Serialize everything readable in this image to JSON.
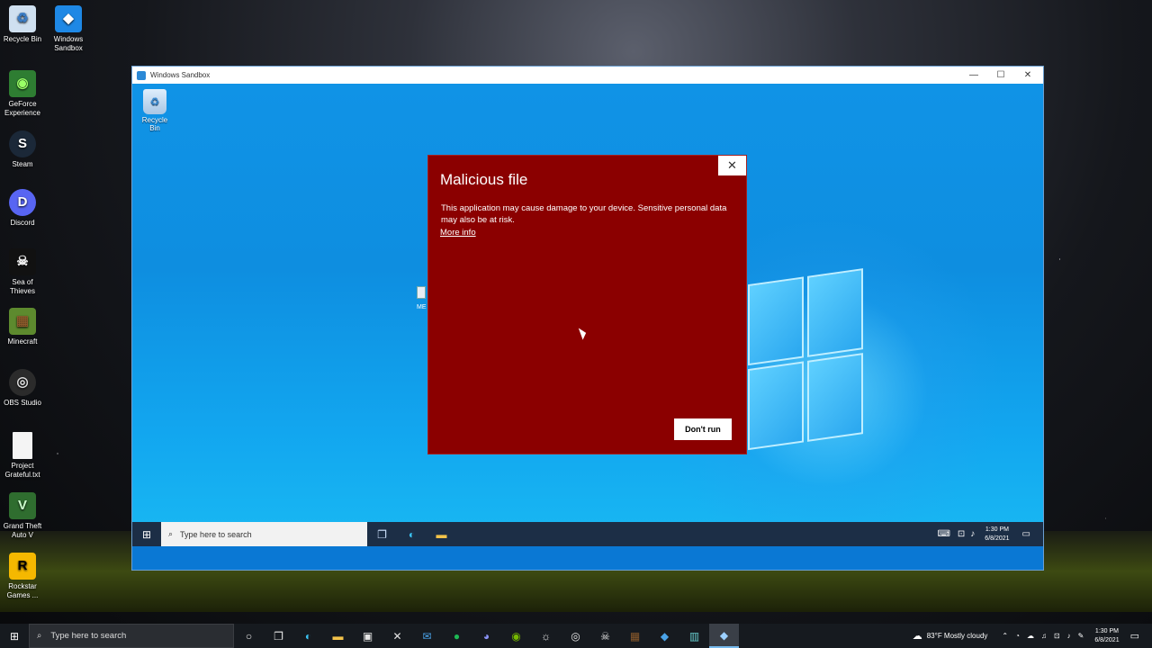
{
  "host_desktop": {
    "icons": [
      {
        "label": "Recycle Bin",
        "glyph": "♻",
        "color": "#cfe0f0",
        "icon": "recycle-bin-icon"
      },
      {
        "label": "Windows Sandbox",
        "glyph": "◆",
        "color": "#1e88e5",
        "icon": "windows-sandbox-icon"
      },
      {
        "label": "GeForce Experience",
        "glyph": "◉",
        "color": "#2e7d32",
        "icon": "geforce-icon"
      },
      {
        "label": "Steam",
        "glyph": "S",
        "color": "#1b2838",
        "icon": "steam-icon"
      },
      {
        "label": "Discord",
        "glyph": "D",
        "color": "#5865f2",
        "icon": "discord-icon"
      },
      {
        "label": "Sea of Thieves",
        "glyph": "☠",
        "color": "#111111",
        "icon": "sea-of-thieves-icon"
      },
      {
        "label": "Minecraft",
        "glyph": "▦",
        "color": "#5d8a2e",
        "icon": "minecraft-icon"
      },
      {
        "label": "OBS Studio",
        "glyph": "◎",
        "color": "#2b2b2b",
        "icon": "obs-icon"
      },
      {
        "label": "Project Grateful.txt",
        "glyph": "",
        "color": "#f4f4f4",
        "icon": "text-file-icon"
      },
      {
        "label": "Grand Theft Auto V",
        "glyph": "V",
        "color": "#2f6d2f",
        "icon": "gta-icon"
      },
      {
        "label": "Rockstar Games ...",
        "glyph": "R",
        "color": "#f5b800",
        "icon": "rockstar-icon"
      }
    ]
  },
  "window": {
    "title": "Windows Sandbox",
    "minimize": "—",
    "maximize": "☐",
    "close": "✕"
  },
  "sandbox": {
    "recycle_label": "Recycle Bin",
    "file_label": "ME",
    "dialog": {
      "title": "Malicious file",
      "message": "This application may cause damage to your device. Sensitive personal data may also be at risk.",
      "link": "More info",
      "button": "Don't run",
      "close": "✕",
      "bg_color": "#8b0000"
    },
    "taskbar": {
      "search_placeholder": "Type here to search",
      "time": "1:30 PM",
      "date": "6/8/2021"
    }
  },
  "host_taskbar": {
    "search_placeholder": "Type here to search",
    "weather": "83°F  Mostly cloudy",
    "time": "1:30 PM",
    "date": "6/8/2021"
  }
}
